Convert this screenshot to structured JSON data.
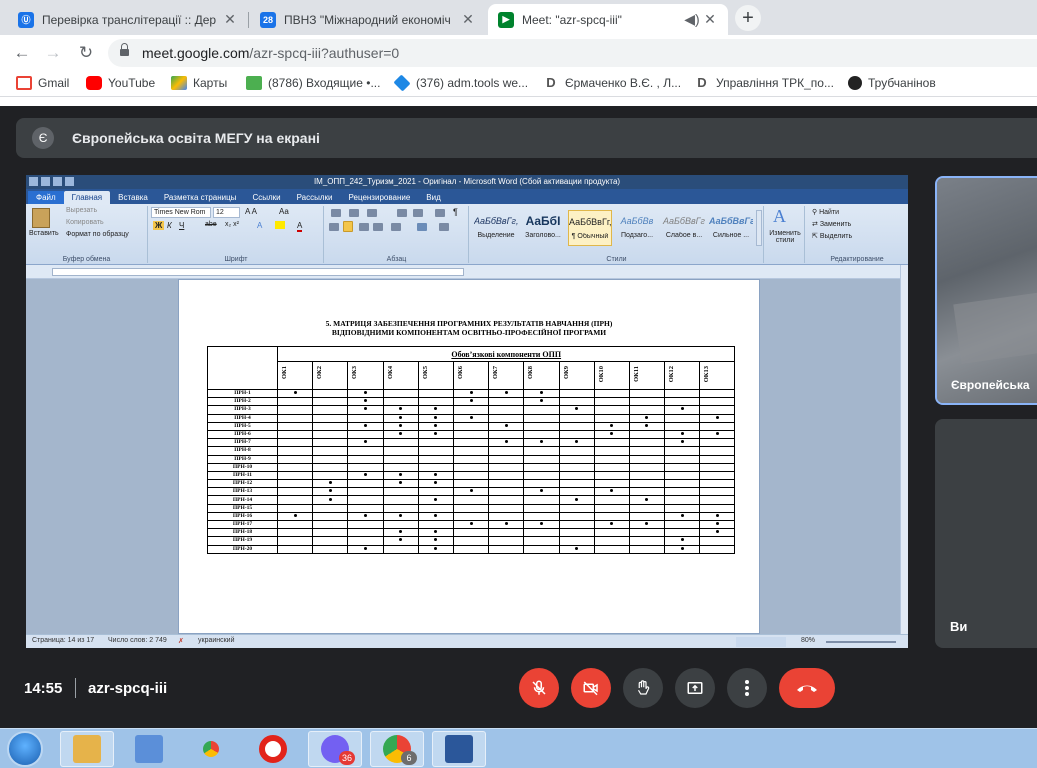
{
  "browser": {
    "tabs": [
      {
        "title": "Перевірка транслітерації :: Дер",
        "color": "#1a73e8",
        "icon": "ua-emblem-icon"
      },
      {
        "title": "ПВНЗ \"Міжнародний економіч",
        "color": "#1a73e8",
        "icon": "calendar-icon",
        "icon_text": "28"
      },
      {
        "title": "Meet: \"azr-spcq-iii\"",
        "color": "#00832d",
        "icon": "meet-icon",
        "active": true
      }
    ],
    "url_host": "meet.google.com",
    "url_path": "/azr-spcq-iii?authuser=0",
    "bookmarks": [
      {
        "label": "Gmail",
        "icon": "gmail-icon",
        "color": "#ea4335"
      },
      {
        "label": "YouTube",
        "icon": "youtube-icon",
        "color": "#ff0000"
      },
      {
        "label": "Карты",
        "icon": "maps-icon",
        "color": "#34a853"
      },
      {
        "label": "(8786) Входящие •...",
        "icon": "mail-icon",
        "color": "#4caf50"
      },
      {
        "label": "(376) adm.tools we...",
        "icon": "admtools-icon",
        "color": "#1e88e5"
      },
      {
        "label": "Єрмаченко В.Є. , Л...",
        "icon": "d-icon",
        "color": "#555555"
      },
      {
        "label": "Управління ТРК_по...",
        "icon": "d-icon",
        "color": "#555555"
      },
      {
        "label": "Трубчанінов",
        "icon": "globe-icon",
        "color": "#222222"
      }
    ]
  },
  "meet": {
    "banner": {
      "avatar": "Є",
      "text": "Європейська освіта МЕГУ на екрані"
    },
    "tiles": [
      {
        "name": "Європейська"
      },
      {
        "name": "Ви"
      }
    ],
    "time": "14:55",
    "code": "azr-spcq-iii"
  },
  "word": {
    "title": "IM_ОПП_242_Туризм_2021 - Оригінал - Microsoft Word (Сбой активации продукта)",
    "tabs": [
      "Файл",
      "Главная",
      "Вставка",
      "Разметка страницы",
      "Ссылки",
      "Рассылки",
      "Рецензирование",
      "Вид"
    ],
    "clipboard": {
      "paste": "Вставить",
      "cut": "Вырезать",
      "copy": "Копировать",
      "format": "Формат по образцу",
      "label": "Буфер обмена"
    },
    "font": {
      "name": "Times New Rom",
      "size": "12",
      "label": "Шрифт"
    },
    "paragraph_label": "Абзац",
    "styles": [
      {
        "preview": "АаБбВвГг,",
        "name": "Выделение"
      },
      {
        "preview": "АаБбІ",
        "name": "Заголово..."
      },
      {
        "preview": "АаБбВвГг,",
        "name": "¶ Обычный"
      },
      {
        "preview": "АаБбВв",
        "name": "Подзаго..."
      },
      {
        "preview": "АаБбВвГг",
        "name": "Слабое в..."
      },
      {
        "preview": "АаБбВвГг",
        "name": "Сильное ..."
      }
    ],
    "styles_label": "Стили",
    "change_styles": "Изменить стили",
    "edit": {
      "find": "Найти",
      "replace": "Заменить",
      "select": "Выделить",
      "label": "Редактирование"
    },
    "status": {
      "page": "Страница: 14 из 17",
      "words": "Число слов: 2 749",
      "lang": "украинский",
      "zoom": "80%"
    },
    "doc": {
      "title_line1": "5. МАТРИЦЯ ЗАБЕЗПЕЧЕННЯ ПРОГРАМНИХ РЕЗУЛЬТАТІВ НАВЧАННЯ (ПРН)",
      "title_line2": "ВІДПОВІДНИМИ КОМПОНЕНТАМ ОСВІТНЬО-ПРОФЕСІЙНОЇ ПРОГРАМИ",
      "header": "Обов’язкові компоненти ОПП",
      "columns": [
        "ОК1",
        "ОК2",
        "ОК3",
        "ОК4",
        "ОК5",
        "ОК6",
        "ОК7",
        "ОК8",
        "ОК9",
        "ОК10",
        "ОК11",
        "ОК12",
        "ОК13"
      ],
      "rows": [
        {
          "label": "ПРН-1",
          "marks": [
            1,
            3,
            6,
            7,
            8
          ]
        },
        {
          "label": "ПРН-2",
          "marks": [
            3,
            6,
            8
          ]
        },
        {
          "label": "ПРН-3",
          "marks": [
            3,
            4,
            5,
            9,
            12
          ]
        },
        {
          "label": "ПРН-4",
          "marks": [
            4,
            5,
            6,
            11,
            13
          ]
        },
        {
          "label": "ПРН-5",
          "marks": [
            3,
            4,
            5,
            7,
            10,
            11
          ]
        },
        {
          "label": "ПРН-6",
          "marks": [
            4,
            5,
            10,
            12,
            13
          ]
        },
        {
          "label": "ПРН-7",
          "marks": [
            3,
            7,
            8,
            9,
            12
          ]
        },
        {
          "label": "ПРН-8",
          "marks": []
        },
        {
          "label": "ПРН-9",
          "marks": []
        },
        {
          "label": "ПРН-10",
          "marks": []
        },
        {
          "label": "ПРН-11",
          "marks": [
            3,
            4,
            5
          ]
        },
        {
          "label": "ПРН-12",
          "marks": [
            2,
            4,
            5
          ]
        },
        {
          "label": "ПРН-13",
          "marks": [
            2,
            6,
            8,
            10
          ]
        },
        {
          "label": "ПРН-14",
          "marks": [
            2,
            5,
            9,
            11
          ]
        },
        {
          "label": "ПРН-15",
          "marks": []
        },
        {
          "label": "ПРН-16",
          "marks": [
            1,
            3,
            4,
            5,
            12,
            13
          ]
        },
        {
          "label": "ПРН-17",
          "marks": [
            6,
            7,
            8,
            10,
            11,
            13
          ]
        },
        {
          "label": "ПРН-18",
          "marks": [
            4,
            5,
            13
          ]
        },
        {
          "label": "ПРН-19",
          "marks": [
            4,
            5,
            12
          ]
        },
        {
          "label": "ПРН-20",
          "marks": [
            3,
            5,
            9,
            12
          ]
        }
      ]
    }
  },
  "taskbar": {
    "apps": [
      {
        "name": "explorer",
        "color": "#e6b34a",
        "active": true
      },
      {
        "name": "media",
        "color": "#5b8fd9"
      },
      {
        "name": "chrome",
        "color": "#34a853"
      },
      {
        "name": "opera",
        "color": "#e2231a"
      },
      {
        "name": "viber",
        "color": "#7360f2",
        "badge": "36",
        "active": true
      },
      {
        "name": "chrome-profile",
        "color": "#34a853",
        "badge": "6",
        "active": true
      },
      {
        "name": "word",
        "color": "#2b579a",
        "active": true
      }
    ]
  }
}
